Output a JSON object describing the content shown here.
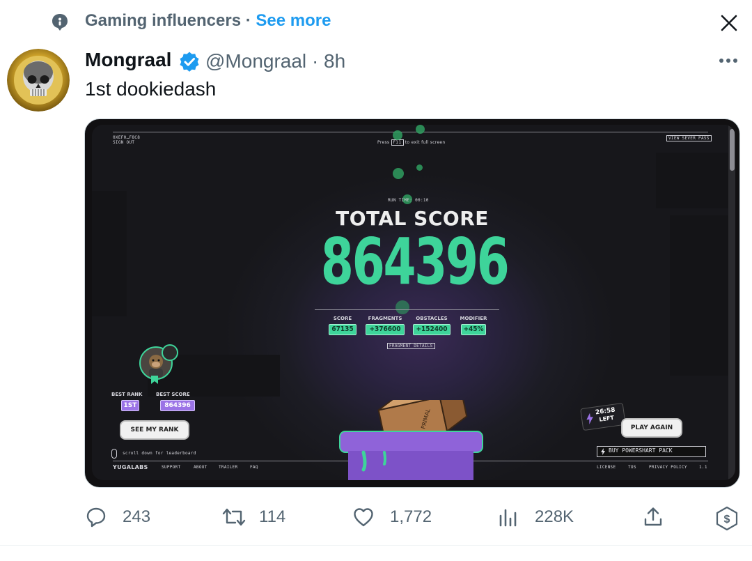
{
  "context": {
    "label": "Gaming influencers",
    "separator": "·",
    "see_more": "See more"
  },
  "author": {
    "name": "Mongraal",
    "handle": "@Mongraal",
    "separator": "·",
    "time": "8h",
    "verified": true
  },
  "tweet": {
    "text": "1st dookiedash"
  },
  "media": {
    "top_left_line1": "0XEF0…F8C8",
    "top_left_line2": "SIGN OUT",
    "fullscreen_press": "Press",
    "fullscreen_key": "F11",
    "fullscreen_rest": "to exit full screen",
    "view_server_pass": "VIEW SEVER PASS",
    "run_time": "RUN TIME: 00:10",
    "headline": "TOTAL SCORE",
    "total_score": "864396",
    "stats": [
      {
        "label": "SCORE",
        "value": "67135"
      },
      {
        "label": "FRAGMENTS",
        "value": "+376600"
      },
      {
        "label": "OBSTACLES",
        "value": "+152400"
      },
      {
        "label": "MODIFIER",
        "value": "+45%"
      }
    ],
    "fragment_details": "FRAGMENT DETAILS",
    "best_rank_label": "BEST RANK",
    "best_rank": "1ST",
    "best_score_label": "BEST SCORE",
    "best_score": "864396",
    "see_my_rank": "SEE MY RANK",
    "scroll_hint": "scroll down for leaderboard",
    "timer": "26:58",
    "timer_left": "LEFT",
    "play_again": "PLAY AGAIN",
    "buy_pack": "BUY POWERSHART PACK",
    "footer_brand": "YUGALABS",
    "footer_links": [
      "SUPPORT",
      "ABOUT",
      "TRAILER",
      "FAQ"
    ],
    "footer_right": [
      "LICENSE",
      "TOS",
      "PRIVACY POLICY",
      "1.1"
    ],
    "box_label": "PRIMAL"
  },
  "actions": {
    "replies": "243",
    "retweets": "114",
    "likes": "1,772",
    "views": "228K"
  },
  "colors": {
    "accent": "#1d9bf0",
    "secondary_text": "#536471",
    "score_green": "#3ed49a",
    "rank_purple": "#9b73e6"
  }
}
